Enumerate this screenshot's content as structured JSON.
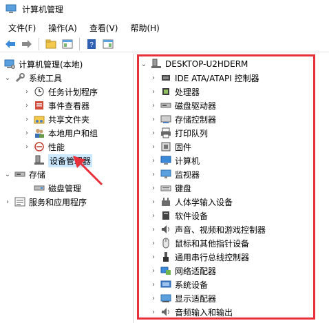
{
  "window": {
    "title": "计算机管理"
  },
  "menu": [
    "文件(F)",
    "操作(A)",
    "查看(V)",
    "帮助(H)"
  ],
  "left_tree": {
    "root": "计算机管理(本地)",
    "system_tools": "系统工具",
    "items": [
      "任务计划程序",
      "事件查看器",
      "共享文件夹",
      "本地用户和组",
      "性能",
      "设备管理器"
    ],
    "storage": "存储",
    "storage_items": [
      "磁盘管理"
    ],
    "services": "服务和应用程序"
  },
  "right_tree": {
    "computer": "DESKTOP-U2HDERM",
    "devices": [
      {
        "label": "IDE ATA/ATAPI 控制器",
        "icon": "ide-controller-icon"
      },
      {
        "label": "处理器",
        "icon": "processor-icon"
      },
      {
        "label": "磁盘驱动器",
        "icon": "disk-drive-icon"
      },
      {
        "label": "存储控制器",
        "icon": "storage-controller-icon"
      },
      {
        "label": "打印队列",
        "icon": "printer-icon"
      },
      {
        "label": "固件",
        "icon": "firmware-icon"
      },
      {
        "label": "计算机",
        "icon": "computer-icon"
      },
      {
        "label": "监视器",
        "icon": "monitor-icon"
      },
      {
        "label": "键盘",
        "icon": "keyboard-icon"
      },
      {
        "label": "人体学输入设备",
        "icon": "hid-icon"
      },
      {
        "label": "软件设备",
        "icon": "software-device-icon"
      },
      {
        "label": "声音、视频和游戏控制器",
        "icon": "sound-icon"
      },
      {
        "label": "鼠标和其他指针设备",
        "icon": "mouse-icon"
      },
      {
        "label": "通用串行总线控制器",
        "icon": "usb-icon"
      },
      {
        "label": "网络适配器",
        "icon": "network-adapter-icon"
      },
      {
        "label": "系统设备",
        "icon": "system-device-icon"
      },
      {
        "label": "显示适配器",
        "icon": "display-adapter-icon"
      },
      {
        "label": "音频输入和输出",
        "icon": "audio-io-icon"
      }
    ]
  },
  "colors": {
    "highlight": "#e8303a",
    "selection": "#cce8ff"
  }
}
